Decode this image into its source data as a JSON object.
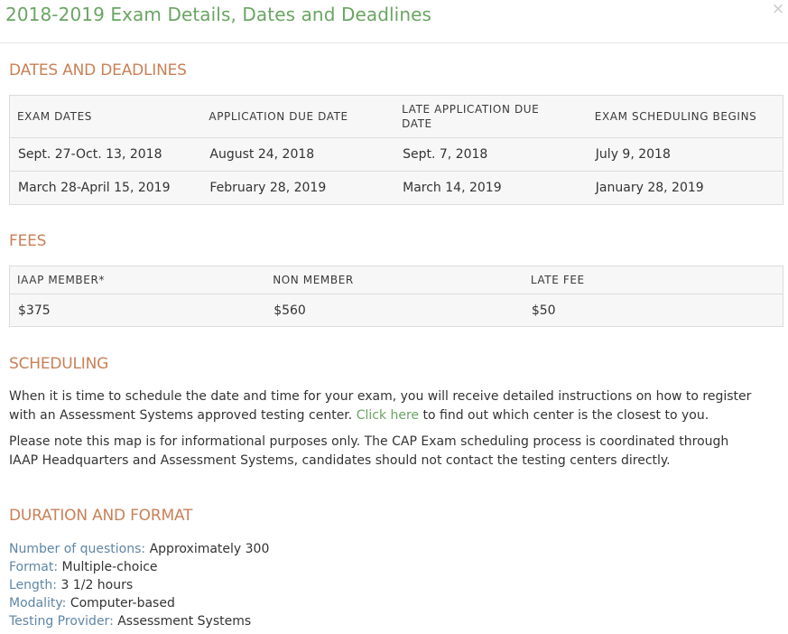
{
  "modal": {
    "title": "2018-2019 Exam Details, Dates and Deadlines",
    "close_label": "×"
  },
  "dates_section": {
    "heading": "DATES AND DEADLINES",
    "columns": [
      "EXAM DATES",
      "APPLICATION DUE DATE",
      "LATE APPLICATION DUE DATE",
      "EXAM SCHEDULING BEGINS"
    ],
    "rows": [
      [
        "Sept. 27-Oct. 13, 2018",
        "August 24, 2018",
        "Sept. 7, 2018",
        "July 9, 2018"
      ],
      [
        "March 28-April 15, 2019",
        "February 28, 2019",
        "March 14, 2019",
        "January 28, 2019"
      ]
    ]
  },
  "fees_section": {
    "heading": "FEES",
    "columns": [
      "IAAP MEMBER*",
      "NON MEMBER",
      "LATE FEE"
    ],
    "rows": [
      [
        "$375",
        "$560",
        "$50"
      ]
    ]
  },
  "scheduling_section": {
    "heading": "SCHEDULING",
    "para1_before_link": "When it is time to schedule the date and time for your exam, you will receive detailed instructions on how to register with an Assessment Systems approved testing center. ",
    "para1_link": "Click here",
    "para1_after_link": " to find out which center is the closest to you.",
    "para2": "Please note this map is for informational purposes only. The CAP Exam scheduling process is coordinated through IAAP Headquarters and Assessment Systems, candidates should not contact the testing centers directly."
  },
  "duration_section": {
    "heading": "DURATION AND FORMAT",
    "items": [
      {
        "label": "Number of questions:",
        "value": "Approximately 300"
      },
      {
        "label": "Format:",
        "value": "Multiple-choice"
      },
      {
        "label": "Length:",
        "value": "3 1/2 hours"
      },
      {
        "label": "Modality:",
        "value": "Computer-based"
      },
      {
        "label": "Testing Provider:",
        "value": "Assessment Systems"
      }
    ]
  },
  "colors": {
    "title_green": "#6aa563",
    "heading_orange": "#c98057",
    "label_blue": "#5f86a5",
    "link_green": "#6aa563"
  }
}
